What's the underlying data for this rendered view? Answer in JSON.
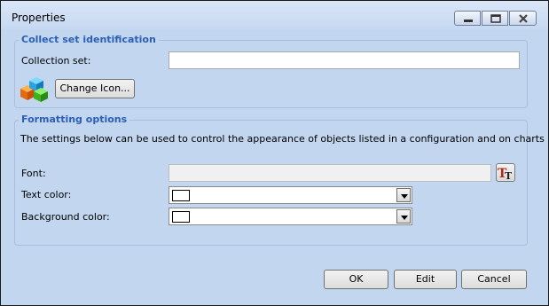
{
  "window": {
    "title": "Properties"
  },
  "identification": {
    "legend": "Collect set identification",
    "collection_label": "Collection set:",
    "collection_value": "",
    "change_icon_label": "Change Icon..."
  },
  "formatting": {
    "legend": "Formatting options",
    "description": "The settings below can be used to control the appearance of objects listed in a configuration and on charts",
    "font_label": "Font:",
    "font_value": "",
    "text_color_label": "Text color:",
    "text_color_value": "#ffffff",
    "background_color_label": "Background color:",
    "background_color_value": "#ffffff"
  },
  "buttons": {
    "ok": "OK",
    "edit": "Edit",
    "cancel": "Cancel"
  },
  "colors": {
    "dialog_bg": "#c3d6f0",
    "legend_text": "#2c5fb2",
    "close_icon": "#c0392b"
  },
  "icons": {
    "window_controls": [
      "minimize-icon",
      "maximize-icon",
      "close-icon"
    ],
    "collection_icon": "colored-cubes-icon",
    "font_picker_icon": "font-tt-icon",
    "dropdown_icon": "chevron-down-icon"
  }
}
